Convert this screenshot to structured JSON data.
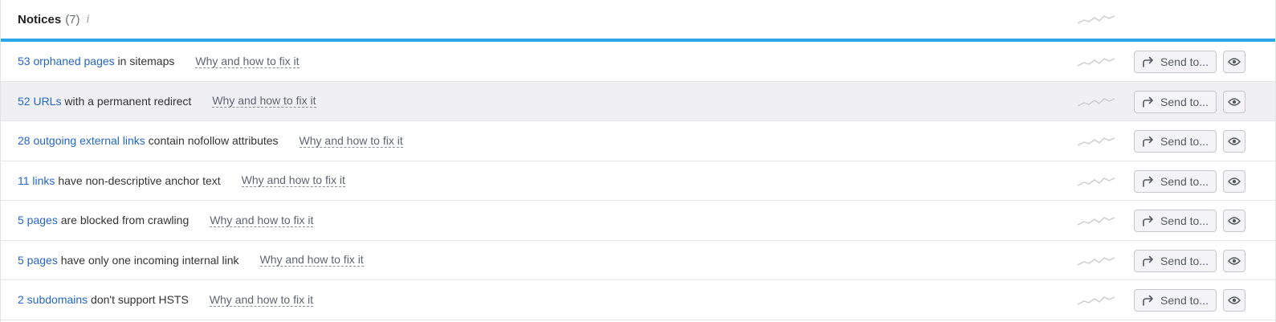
{
  "header": {
    "title": "Notices",
    "count": "(7)",
    "info_glyph": "i"
  },
  "colors": {
    "accent": "#2ba6ea",
    "link": "#2466c4",
    "hover_row": "#f0f0f4"
  },
  "rows": [
    {
      "link": "53 orphaned pages",
      "text": " in sitemaps",
      "why": "Why and how to fix it",
      "send": "Send to..."
    },
    {
      "link": "52 URLs",
      "text": " with a permanent redirect",
      "why": "Why and how to fix it",
      "send": "Send to..."
    },
    {
      "link": "28 outgoing external links",
      "text": " contain nofollow attributes",
      "why": "Why and how to fix it",
      "send": "Send to..."
    },
    {
      "link": "11 links",
      "text": " have non-descriptive anchor text",
      "why": "Why and how to fix it",
      "send": "Send to..."
    },
    {
      "link": "5 pages",
      "text": " are blocked from crawling",
      "why": "Why and how to fix it",
      "send": "Send to..."
    },
    {
      "link": "5 pages",
      "text": " have only one incoming internal link",
      "why": "Why and how to fix it",
      "send": "Send to..."
    },
    {
      "link": "2 subdomains",
      "text": " don't support HSTS",
      "why": "Why and how to fix it",
      "send": "Send to..."
    }
  ],
  "icons": {
    "trend": "sparkline-icon",
    "send": "share-arrow-icon",
    "hide": "eye-icon",
    "info": "info-icon"
  }
}
